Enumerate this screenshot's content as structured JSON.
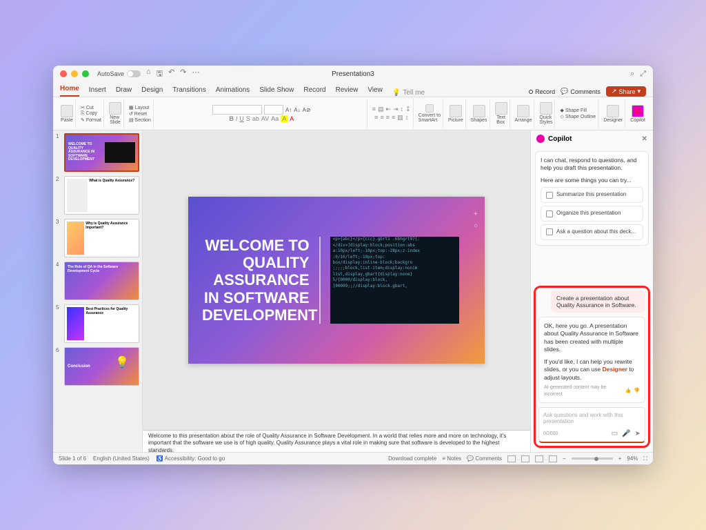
{
  "titlebar": {
    "autosave": "AutoSave",
    "title": "Presentation3"
  },
  "tabs": [
    "Home",
    "Insert",
    "Draw",
    "Design",
    "Transitions",
    "Animations",
    "Slide Show",
    "Record",
    "Review",
    "View"
  ],
  "tellme": "Tell me",
  "record": "Record",
  "comments": "Comments",
  "share": "Share",
  "ribbon": {
    "paste": "Paste",
    "cut": "Cut",
    "copy": "Copy",
    "format": "Format",
    "newslide": "New\nSlide",
    "layout": "Layout",
    "reset": "Reset",
    "section": "Section",
    "convert": "Convert to\nSmartArt",
    "picture": "Picture",
    "shapes": "Shapes",
    "textbox": "Text\nBox",
    "arrange": "Arrange",
    "quick": "Quick\nStyles",
    "shapefill": "Shape Fill",
    "shapeoutline": "Shape Outline",
    "designer": "Designer",
    "copilot": "Copilot"
  },
  "thumbs": [
    {
      "n": "1",
      "title": "WELCOME TO QUALITY ASSURANCE IN SOFTWARE DEVELOPMENT",
      "type": "grad"
    },
    {
      "n": "2",
      "title": "What is Quality Assurance?",
      "type": "white"
    },
    {
      "n": "3",
      "title": "Why is Quality Assurance Important?",
      "type": "white"
    },
    {
      "n": "4",
      "title": "The Role of QA in the Software Development Cycle",
      "type": "grad2"
    },
    {
      "n": "5",
      "title": "Best Practices for Quality Assurance",
      "type": "white"
    },
    {
      "n": "6",
      "title": "Conclusion",
      "type": "grad3"
    }
  ],
  "slide": {
    "title": "WELCOME TO QUALITY ASSURANCE IN SOFTWARE DEVELOPMENT"
  },
  "notes": "Welcome to this presentation about the role of Quality Assurance in Software Development. In a world that relies more and more on technology, it's important that the software we use is of high quality. Quality Assurance plays a vital role in making sure that software is developed to the highest standards.",
  "copilot": {
    "title": "Copilot",
    "intro1": "I can chat, respond to questions, and help you draft this presentation.",
    "intro2": "Here are some things you can try...",
    "sug1": "Summarize this presentation",
    "sug2": "Organize this presentation",
    "sug3": "Ask a question about this deck...",
    "user": "Create a presentation about Quality Assurance in Software.",
    "resp1": "OK, here you go. A presentation about Quality Assurance in Software has been created with multiple slides.",
    "resp2a": "If you'd like, I can help you rewrite slides, or you can use ",
    "resp2b": "Designer",
    "resp2c": " to adjust layouts.",
    "disc": "AI-generated content may be incorrect",
    "placeholder": "Ask questions and work with this presentation",
    "counter": "0/2000"
  },
  "status": {
    "slide": "Slide 1 of 6",
    "lang": "English (United States)",
    "acc": "Accessibility: Good to go",
    "dl": "Download complete",
    "notes": "Notes",
    "comments": "Comments",
    "zoom": "94%"
  }
}
